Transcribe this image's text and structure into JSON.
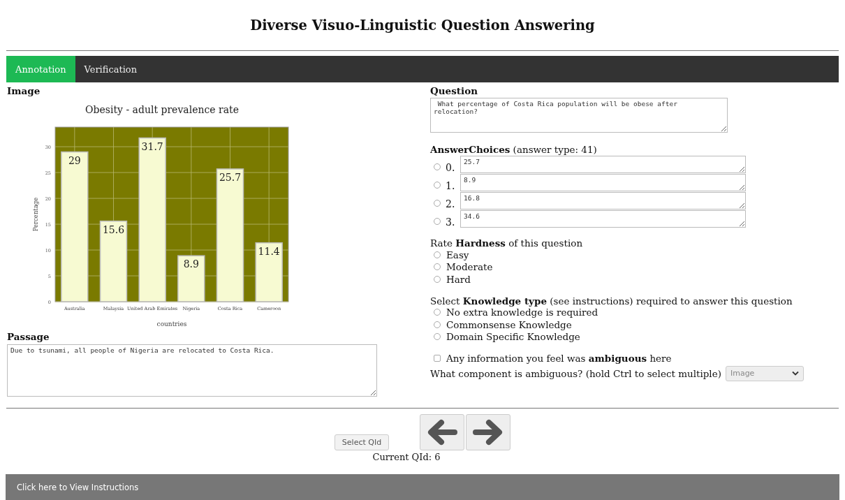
{
  "page_title": "Diverse Visuo-Linguistic Question Answering",
  "tabs": [
    {
      "label": "Annotation",
      "selected": true
    },
    {
      "label": "Verification",
      "selected": false
    }
  ],
  "image_section": {
    "heading": "Image",
    "chart_data": {
      "type": "bar",
      "title": "Obesity - adult prevalence rate",
      "xlabel": "countries",
      "ylabel": "Percentage",
      "categories": [
        "Australia",
        "Malaysia",
        "United Arab Emirates",
        "Nigeria",
        "Costa Rica",
        "Cameroon"
      ],
      "values": [
        29,
        15.6,
        31.7,
        8.9,
        25.7,
        11.4
      ],
      "ylim": [
        0,
        33.8
      ],
      "yticks": [
        0,
        5,
        10,
        15,
        20,
        25,
        30
      ],
      "data_labels": true,
      "grid": true
    }
  },
  "passage": {
    "heading": "Passage",
    "value": "Due to tsunami, all people of Nigeria are relocated to Costa Rica."
  },
  "question": {
    "heading": "Question",
    "value": " What percentage of Costa Rica population will be obese after relocation?"
  },
  "answer_choices": {
    "heading": "**AnswerChoices** (answer type: 41)",
    "choices": [
      {
        "index": "0.",
        "value": "25.7",
        "selected": false
      },
      {
        "index": "1.",
        "value": "8.9",
        "selected": false
      },
      {
        "index": "2.",
        "value": "16.8",
        "selected": false
      },
      {
        "index": "3.",
        "value": "34.6",
        "selected": false
      }
    ]
  },
  "hardness": {
    "label": "Rate **Hardness** of this question",
    "options": [
      {
        "label": "Easy",
        "selected": false
      },
      {
        "label": "Moderate",
        "selected": false
      },
      {
        "label": "Hard",
        "selected": false
      }
    ]
  },
  "knowledge": {
    "label": "Select **Knowledge type** (see instructions) required to answer this question",
    "options": [
      {
        "label": "No extra knowledge is required",
        "selected": false
      },
      {
        "label": "Commonsense Knowledge",
        "selected": false
      },
      {
        "label": "Domain Specific Knowledge",
        "selected": false
      }
    ]
  },
  "ambiguous": {
    "label": "Any information you feel was **ambiguous** here",
    "checked": false
  },
  "component": {
    "label": "What component is ambiguous? (hold Ctrl to select multiple)",
    "value": "Image"
  },
  "select_qid_button": "Select QId",
  "current_qid": "Current QId: 6",
  "footer": "Click here to View Instructions"
}
